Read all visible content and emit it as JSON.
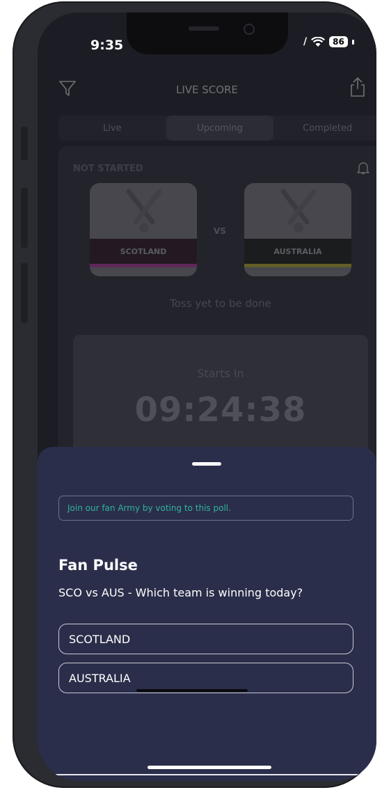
{
  "status_bar": {
    "time": "9:35",
    "battery": "86"
  },
  "header": {
    "title": "LIVE SCORE"
  },
  "tabs": [
    {
      "label": "Live",
      "active": false
    },
    {
      "label": "Upcoming",
      "active": true
    },
    {
      "label": "Completed",
      "active": false
    }
  ],
  "match": {
    "status": "NOT STARTED",
    "team1": {
      "name": "SCOTLAND",
      "band_color": "#2a1523",
      "stripe_color": "#b2349a"
    },
    "team2": {
      "name": "AUSTRALIA",
      "band_color": "#1b1c16",
      "stripe_color": "#b8ac2a"
    },
    "vs_label": "VS",
    "toss": "Toss yet to be done",
    "countdown": {
      "label": "Starts In",
      "time": "09:24:38"
    }
  },
  "poll": {
    "notice": "Join our fan Army by voting to this poll.",
    "title": "Fan Pulse",
    "question": "SCO vs AUS - Which team is winning today?",
    "options": [
      {
        "label": "SCOTLAND"
      },
      {
        "label": "AUSTRALIA"
      }
    ]
  },
  "colors": {
    "sheet_bg": "#2b2e4a",
    "notice_text": "#2fb59b",
    "screen_bg": "#1c1d24"
  }
}
